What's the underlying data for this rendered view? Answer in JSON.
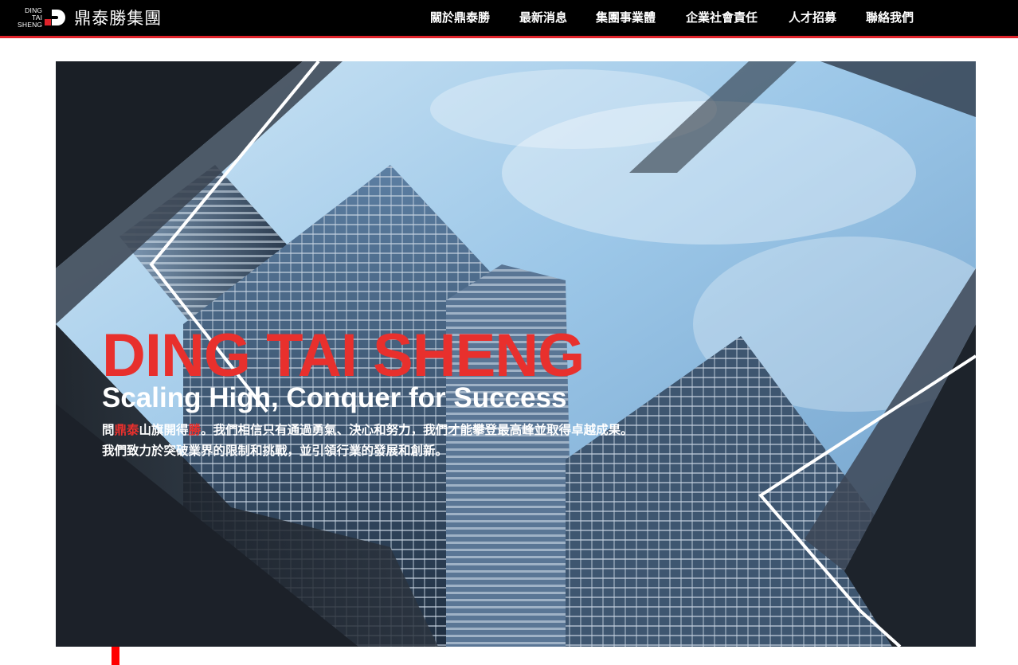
{
  "header": {
    "logo": {
      "lines": [
        "DING",
        "TAI",
        "SHENG"
      ],
      "name": "鼎泰勝集團"
    },
    "nav": [
      {
        "label": "關於鼎泰勝"
      },
      {
        "label": "最新消息"
      },
      {
        "label": "集團事業體"
      },
      {
        "label": "企業社會責任"
      },
      {
        "label": "人才招募"
      },
      {
        "label": "聯絡我們"
      }
    ]
  },
  "hero": {
    "brand": "DING TAI SHENG",
    "tagline": "Scaling High, Conquer for Success",
    "description": {
      "p1": "問",
      "h1": "鼎泰",
      "p2": "山旗開得",
      "h2": "勝",
      "p3": "。我們相信只有通過勇氣、決心和努力，我們才能攀登最高峰並取得卓越成果。我們致力於突破業界的限制和挑戰，並引領行業的發展和創新。"
    }
  },
  "colors": {
    "header_bg": "#000000",
    "accent_red": "#e0232b",
    "brand_red": "#e8302d",
    "text_white": "#ffffff"
  }
}
